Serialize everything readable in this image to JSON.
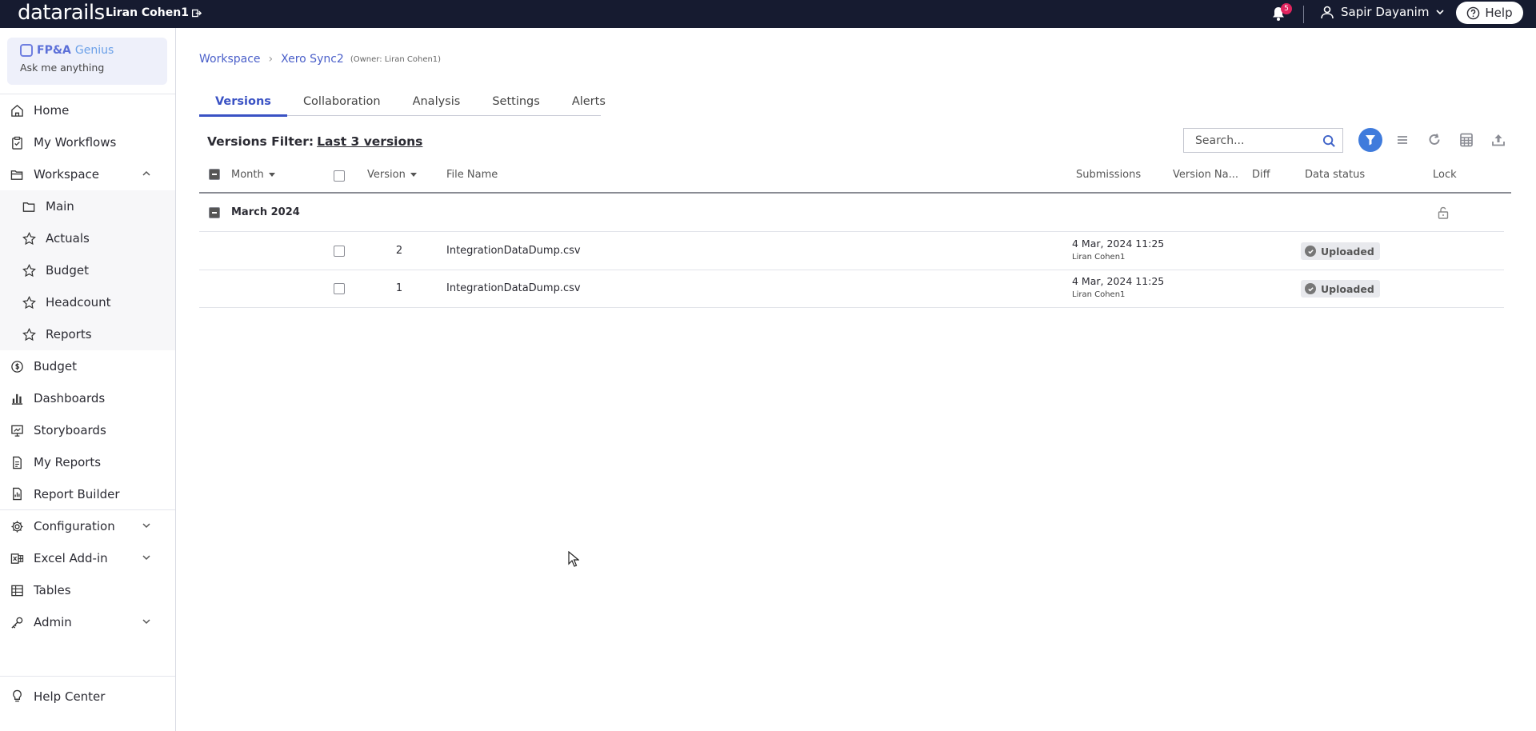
{
  "topbar": {
    "logo": "datarails",
    "owner": "Liran Cohen1",
    "notification_count": "5",
    "user_name": "Sapir Dayanim",
    "help_label": "Help"
  },
  "sidebar": {
    "genius_title_a": "FP&A",
    "genius_title_b": "Genius",
    "genius_subtitle": "Ask me anything",
    "items": [
      {
        "label": "Home"
      },
      {
        "label": "My Workflows"
      },
      {
        "label": "Workspace"
      },
      {
        "label": "Main"
      },
      {
        "label": "Actuals"
      },
      {
        "label": "Budget"
      },
      {
        "label": "Headcount"
      },
      {
        "label": "Reports"
      },
      {
        "label": "Budget"
      },
      {
        "label": "Dashboards"
      },
      {
        "label": "Storyboards"
      },
      {
        "label": "My Reports"
      },
      {
        "label": "Report Builder"
      },
      {
        "label": "Configuration"
      },
      {
        "label": "Excel Add-in"
      },
      {
        "label": "Tables"
      },
      {
        "label": "Admin"
      }
    ],
    "help_center": "Help Center"
  },
  "breadcrumb": {
    "root": "Workspace",
    "current": "Xero Sync2",
    "owner_note": "(Owner: Liran Cohen1)"
  },
  "tabs": [
    {
      "label": "Versions"
    },
    {
      "label": "Collaboration"
    },
    {
      "label": "Analysis"
    },
    {
      "label": "Settings"
    },
    {
      "label": "Alerts"
    }
  ],
  "filter": {
    "label": "Versions Filter:",
    "value": "Last 3 versions"
  },
  "search": {
    "placeholder": "Search..."
  },
  "grid": {
    "columns": {
      "month": "Month",
      "version": "Version",
      "file_name": "File Name",
      "submissions": "Submissions",
      "version_name": "Version Na...",
      "diff": "Diff",
      "data_status": "Data status",
      "lock": "Lock"
    },
    "group": "March 2024",
    "rows": [
      {
        "version": "2",
        "file_name": "IntegrationDataDump.csv",
        "submitted_at": "4 Mar, 2024 11:25",
        "submitted_by": "Liran Cohen1",
        "status": "Uploaded"
      },
      {
        "version": "1",
        "file_name": "IntegrationDataDump.csv",
        "submitted_at": "4 Mar, 2024 11:25",
        "submitted_by": "Liran Cohen1",
        "status": "Uploaded"
      }
    ]
  },
  "colors": {
    "topbar_bg": "#161b30",
    "accent": "#3a52c4",
    "link": "#4a5fc9",
    "badge": "#e0245e",
    "filter_active": "#3f7bdc"
  }
}
